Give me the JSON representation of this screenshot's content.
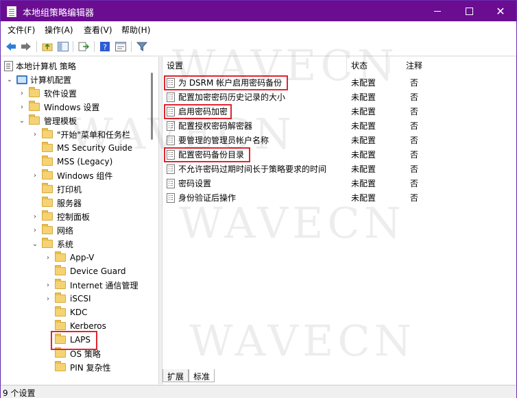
{
  "window": {
    "title": "本地组策略编辑器",
    "close_glyph": "✕"
  },
  "menu": {
    "items": [
      "文件(F)",
      "操作(A)",
      "查看(V)",
      "帮助(H)"
    ]
  },
  "toolbar": {
    "icons": [
      "back-arrow-icon",
      "forward-arrow-icon",
      "up-folder-icon",
      "show-tree-icon",
      "export-icon",
      "help-icon",
      "properties-icon",
      "filter-icon"
    ]
  },
  "tree": {
    "root": "本地计算机 策略",
    "computer_config": "计算机配置",
    "items": [
      {
        "label": "软件设置"
      },
      {
        "label": "Windows 设置"
      },
      {
        "label": "管理模板"
      },
      {
        "label": "\"开始\"菜单和任务栏"
      },
      {
        "label": "MS Security Guide"
      },
      {
        "label": "MSS (Legacy)"
      },
      {
        "label": "Windows 组件"
      },
      {
        "label": "打印机"
      },
      {
        "label": "服务器"
      },
      {
        "label": "控制面板"
      },
      {
        "label": "网络"
      },
      {
        "label": "系统"
      },
      {
        "label": "App-V"
      },
      {
        "label": "Device Guard"
      },
      {
        "label": "Internet 通信管理"
      },
      {
        "label": "iSCSI"
      },
      {
        "label": "KDC"
      },
      {
        "label": "Kerberos"
      },
      {
        "label": "LAPS"
      },
      {
        "label": "OS 策略"
      },
      {
        "label": "PIN 复杂性"
      }
    ]
  },
  "table": {
    "headers": {
      "name": "设置",
      "state": "状态",
      "note": "注释"
    },
    "rows": [
      {
        "name": "为 DSRM 帐户启用密码备份",
        "state": "未配置",
        "note": "否"
      },
      {
        "name": "配置加密密码历史记录的大小",
        "state": "未配置",
        "note": "否"
      },
      {
        "name": "启用密码加密",
        "state": "未配置",
        "note": "否"
      },
      {
        "name": "配置授权密码解密器",
        "state": "未配置",
        "note": "否"
      },
      {
        "name": "要管理的管理员帐户名称",
        "state": "未配置",
        "note": "否"
      },
      {
        "name": "配置密码备份目录",
        "state": "未配置",
        "note": "否"
      },
      {
        "name": "不允许密码过期时间长于策略要求的时间",
        "state": "未配置",
        "note": "否"
      },
      {
        "name": "密码设置",
        "state": "未配置",
        "note": "否"
      },
      {
        "name": "身份验证后操作",
        "state": "未配置",
        "note": "否"
      }
    ]
  },
  "tabs": [
    "扩展",
    "标准"
  ],
  "status": {
    "text": "9 个设置"
  },
  "watermark": "WAVECN",
  "colors": {
    "titlebar": "#6a0d91",
    "highlight": "#e0242f"
  }
}
